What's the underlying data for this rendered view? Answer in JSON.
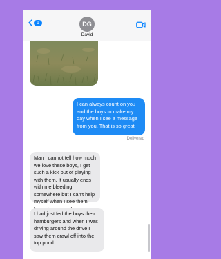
{
  "header": {
    "back_badge": "1",
    "avatar_initials": "DG",
    "contact_name": "David",
    "icons": {
      "back": "chevron-left-icon",
      "video": "video-camera-icon"
    }
  },
  "colors": {
    "background": "#a77be6",
    "outgoing_bubble": "#1e8bf5",
    "incoming_bubble": "#e9e9eb",
    "accent": "#0a84ff"
  },
  "messages": [
    {
      "direction": "incoming",
      "type": "photo",
      "description": "grass field"
    },
    {
      "direction": "outgoing",
      "text": "I can always count on you and the boys to make my day when I see a message from you. That is so great!"
    },
    {
      "direction": "incoming",
      "text": "Man I cannot tell how much we love these boys, I get such a kick out of playing with them. It usually ends with me bleeding somewhere but I can't help myself when I see them bouncing around."
    },
    {
      "direction": "incoming",
      "text": "I had just fed the boys their hamburgers and when I was driving around the drive I saw them crawl off into the top pond"
    }
  ],
  "status": {
    "delivered": "Delivered"
  }
}
